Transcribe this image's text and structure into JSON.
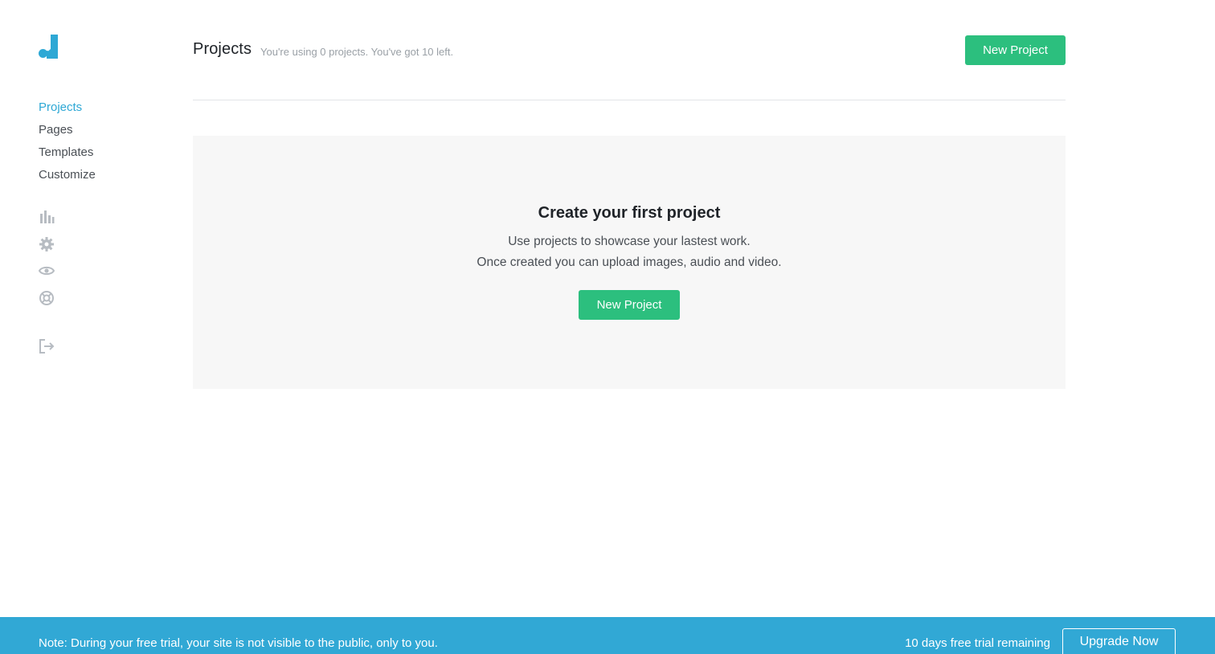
{
  "brand": {
    "logo_icon": "brand-logo-icon",
    "accent_color": "#2ea8d5"
  },
  "sidebar": {
    "nav": [
      {
        "label": "Projects",
        "active": true
      },
      {
        "label": "Pages",
        "active": false
      },
      {
        "label": "Templates",
        "active": false
      },
      {
        "label": "Customize",
        "active": false
      }
    ],
    "icons": [
      "bar-chart-icon",
      "gear-icon",
      "eye-icon",
      "lifebuoy-icon",
      "logout-icon"
    ]
  },
  "header": {
    "title": "Projects",
    "usage": "You're using 0 projects. You've got 10 left.",
    "new_project_label": "New Project"
  },
  "empty_state": {
    "title": "Create your first project",
    "line1": "Use projects to showcase your lastest work.",
    "line2": "Once created you can upload images, audio and video.",
    "button_label": "New Project"
  },
  "notice_bar": {
    "note": "Note: During your free trial, your site is not visible to the public, only to you.",
    "trial_remaining": "10 days free trial remaining",
    "upgrade_label": "Upgrade Now",
    "background_color": "#31a8d5"
  },
  "colors": {
    "primary_button": "#2cbf7e",
    "panel_background": "#f7f7f7"
  }
}
